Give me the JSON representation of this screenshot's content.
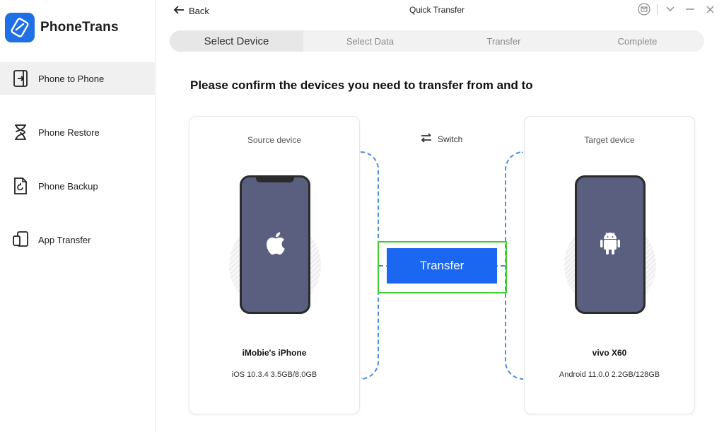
{
  "app": {
    "name": "PhoneTrans",
    "window_title": "Quick Transfer"
  },
  "sidebar": {
    "items": [
      {
        "label": "Phone to Phone",
        "icon": "phone-to-phone-icon",
        "active": true
      },
      {
        "label": "Phone Restore",
        "icon": "hourglass-icon",
        "active": false
      },
      {
        "label": "Phone Backup",
        "icon": "backup-file-icon",
        "active": false
      },
      {
        "label": "App Transfer",
        "icon": "app-transfer-icon",
        "active": false
      }
    ]
  },
  "header": {
    "back_label": "Back"
  },
  "steps": [
    {
      "label": "Select Device",
      "active": true
    },
    {
      "label": "Select Data",
      "active": false
    },
    {
      "label": "Transfer",
      "active": false
    },
    {
      "label": "Complete",
      "active": false
    }
  ],
  "main": {
    "heading": "Please confirm the devices you need to transfer from and to",
    "switch_label": "Switch",
    "transfer_label": "Transfer",
    "source": {
      "title": "Source device",
      "name": "iMobie's iPhone",
      "info": "iOS 10.3.4 3.5GB/8.0GB",
      "icon": "apple-icon"
    },
    "target": {
      "title": "Target device",
      "name": "vivo X60",
      "info": "Android 11.0.0 2.2GB/128GB",
      "icon": "android-icon"
    }
  },
  "colors": {
    "accent": "#1b67f2",
    "brand": "#1f6fe5",
    "phone_screen": "#5a5f80",
    "highlight": "#3fce2f",
    "connector": "#4a8de0"
  }
}
